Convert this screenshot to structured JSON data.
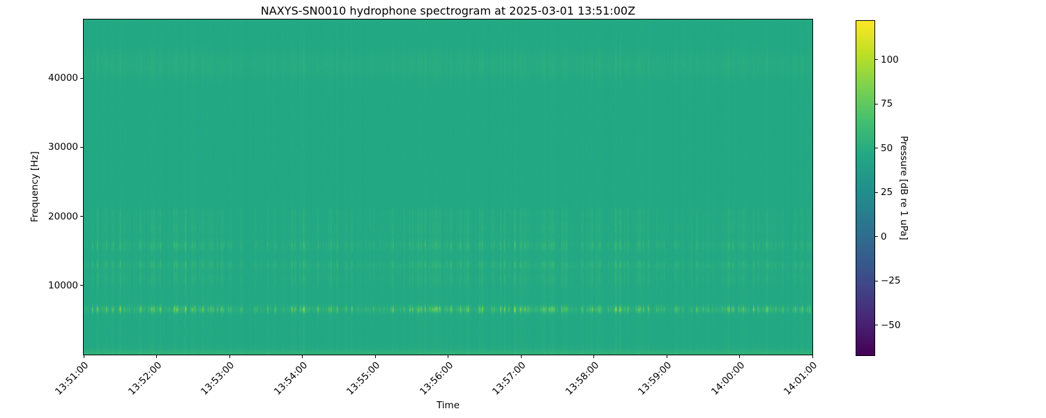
{
  "window": {
    "kind": "matplotlib-figure",
    "background_color": "#ffffff",
    "text_color": "#000000",
    "frame_color": "#000000"
  },
  "chart_data": {
    "type": "heatmap",
    "subtype": "spectrogram",
    "title": "NAXYS-SN0010 hydrophone spectrogram at 2025-03-01 13:51:00Z",
    "xlabel": "Time",
    "ylabel": "Frequency [Hz]",
    "x_ticks": [
      "13:51:00",
      "13:52:00",
      "13:53:00",
      "13:54:00",
      "13:55:00",
      "13:56:00",
      "13:57:00",
      "13:58:00",
      "13:59:00",
      "14:00:00",
      "14:01:00"
    ],
    "x_tick_rotation_deg": 45,
    "duration_seconds": 600,
    "y_ticks": [
      10000,
      20000,
      30000,
      40000
    ],
    "ylim": [
      0,
      48500
    ],
    "grid": false,
    "legend": "none",
    "colorbar": {
      "label": "Pressure [dB re 1 uPa]",
      "ticks": [
        100,
        75,
        50,
        25,
        0,
        -25,
        -50
      ],
      "vmin": -67,
      "vmax": 122,
      "colormap": "viridis",
      "colormap_stops": [
        {
          "pos": 0.0,
          "color": "#440154"
        },
        {
          "pos": 0.1,
          "color": "#482475"
        },
        {
          "pos": 0.2,
          "color": "#414487"
        },
        {
          "pos": 0.3,
          "color": "#355f8d"
        },
        {
          "pos": 0.4,
          "color": "#2a788e"
        },
        {
          "pos": 0.5,
          "color": "#21918c"
        },
        {
          "pos": 0.6,
          "color": "#22a884"
        },
        {
          "pos": 0.7,
          "color": "#44bf70"
        },
        {
          "pos": 0.8,
          "color": "#7ad151"
        },
        {
          "pos": 0.9,
          "color": "#bddf26"
        },
        {
          "pos": 1.0,
          "color": "#fde725"
        }
      ]
    },
    "texture": {
      "seed": 1337,
      "background_db": 46.5,
      "pixel_noise_db": 1.7,
      "column_jitter_db": 0.8,
      "max_db": 103,
      "static_bands": [
        {
          "center_hz": 0,
          "sigma_hz": 450,
          "gain_db": 8.0
        },
        {
          "center_hz": 42000,
          "sigma_hz": 1400,
          "gain_db": 1.7
        },
        {
          "center_hz": 6500,
          "sigma_hz": 400,
          "gain_db": 1.2
        },
        {
          "center_hz": 12700,
          "sigma_hz": 250,
          "gain_db": 0.9
        }
      ],
      "impulse_bands": [
        {
          "center_hz": 6500,
          "sigma_hz": 320,
          "gain_db": 40
        },
        {
          "center_hz": 13000,
          "sigma_hz": 380,
          "gain_db": 12
        },
        {
          "center_hz": 15800,
          "sigma_hz": 500,
          "gain_db": 13
        },
        {
          "center_hz": 11000,
          "sigma_hz": 700,
          "gain_db": 6
        },
        {
          "center_hz": 18500,
          "sigma_hz": 800,
          "gain_db": 5
        },
        {
          "center_hz": 20500,
          "sigma_hz": 450,
          "gain_db": 5
        },
        {
          "center_hz": 42000,
          "sigma_hz": 1500,
          "gain_db": 3
        }
      ],
      "broadband_impulse_db": {
        "below_20khz": 3.2,
        "above_20khz": 1.3
      }
    }
  }
}
